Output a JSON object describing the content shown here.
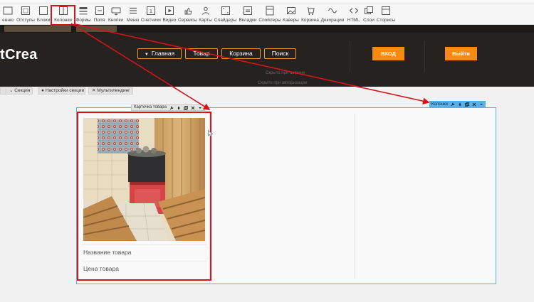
{
  "toolbar": {
    "items": [
      {
        "label": "енню",
        "icon": "partial-icon"
      },
      {
        "label": "Отступы",
        "icon": "padding-icon"
      },
      {
        "label": "Блоки",
        "icon": "blocks-icon"
      },
      {
        "label": "Колонки",
        "icon": "columns-icon"
      },
      {
        "label": "Формы",
        "icon": "forms-icon"
      },
      {
        "label": "Поля",
        "icon": "fields-icon"
      },
      {
        "label": "Кнопки",
        "icon": "buttons-icon"
      },
      {
        "label": "Меню",
        "icon": "menu-icon"
      },
      {
        "label": "Счетчики",
        "icon": "counters-icon"
      },
      {
        "label": "Видео",
        "icon": "video-icon"
      },
      {
        "label": "Сервисы",
        "icon": "services-icon"
      },
      {
        "label": "Карты",
        "icon": "maps-icon"
      },
      {
        "label": "Слайдеры",
        "icon": "sliders-icon"
      },
      {
        "label": "Вкладки",
        "icon": "tabs-icon"
      },
      {
        "label": "Спойлеры",
        "icon": "spoilers-icon"
      },
      {
        "label": "Каверы",
        "icon": "covers-icon"
      },
      {
        "label": "Корзина",
        "icon": "cart-icon"
      },
      {
        "label": "Декорации",
        "icon": "decorations-icon"
      },
      {
        "label": "HTML",
        "icon": "html-icon"
      },
      {
        "label": "Слои",
        "icon": "layers-icon"
      },
      {
        "label": "Сторисы",
        "icon": "stories-icon"
      }
    ]
  },
  "site": {
    "logo": "tCrea",
    "nav": [
      {
        "label": "Главная",
        "has_dropdown": true
      },
      {
        "label": "Товар"
      },
      {
        "label": "Корзина"
      },
      {
        "label": "Поиск"
      }
    ],
    "login_label": "ВХОД",
    "logout_label": "Выйти",
    "subtext_1": "Скрыто при ширине",
    "subtext_2": "Скрыто при авторизации"
  },
  "section_bar": {
    "section_label": "Секция",
    "settings_label": "Настройки секции",
    "multilanding_label": "Мультилендинг"
  },
  "card": {
    "tab_label": "Карточка товара",
    "product_name": "Название товара",
    "product_price": "Цена товара"
  },
  "columns_tab": {
    "label": "Колонки"
  },
  "colors": {
    "accent_orange": "#f38b14",
    "highlight_red": "#d3141a",
    "selection_blue": "#5ab0e6",
    "dark_bg": "#262220"
  }
}
